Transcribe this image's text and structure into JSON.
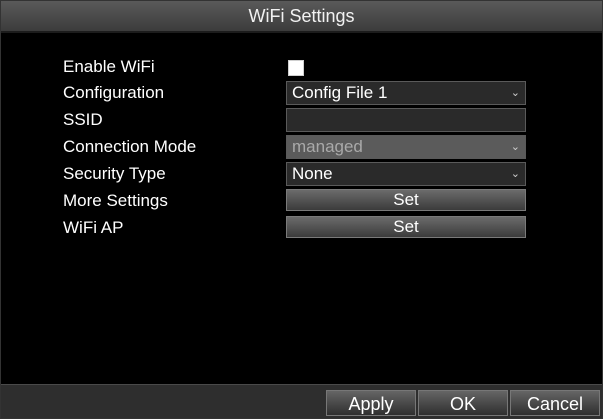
{
  "window": {
    "title": "WiFi Settings"
  },
  "form": {
    "enable_wifi": {
      "label": "Enable WiFi",
      "checked": false
    },
    "configuration": {
      "label": "Configuration",
      "value": "Config File 1"
    },
    "ssid": {
      "label": "SSID",
      "value": ""
    },
    "connection_mode": {
      "label": "Connection Mode",
      "value": "managed",
      "disabled": true
    },
    "security_type": {
      "label": "Security Type",
      "value": "None"
    },
    "more_settings": {
      "label": "More Settings",
      "button": "Set"
    },
    "wifi_ap": {
      "label": "WiFi AP",
      "button": "Set"
    }
  },
  "footer": {
    "apply": "Apply",
    "ok": "OK",
    "cancel": "Cancel"
  }
}
